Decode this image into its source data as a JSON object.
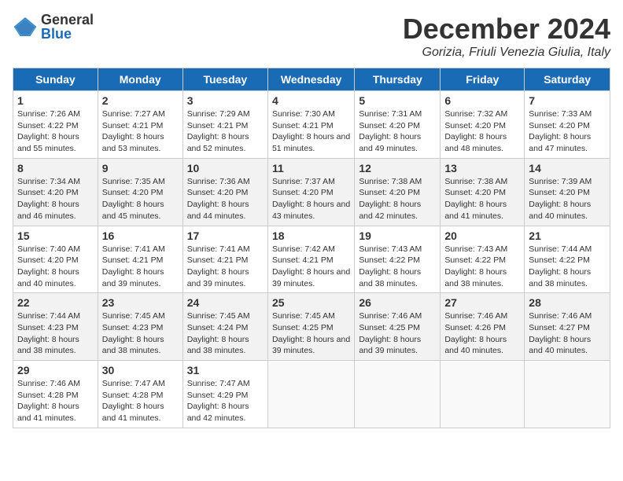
{
  "logo": {
    "general": "General",
    "blue": "Blue"
  },
  "title": "December 2024",
  "subtitle": "Gorizia, Friuli Venezia Giulia, Italy",
  "weekdays": [
    "Sunday",
    "Monday",
    "Tuesday",
    "Wednesday",
    "Thursday",
    "Friday",
    "Saturday"
  ],
  "weeks": [
    [
      {
        "day": "1",
        "sunrise": "7:26 AM",
        "sunset": "4:22 PM",
        "daylight": "8 hours and 55 minutes."
      },
      {
        "day": "2",
        "sunrise": "7:27 AM",
        "sunset": "4:21 PM",
        "daylight": "8 hours and 53 minutes."
      },
      {
        "day": "3",
        "sunrise": "7:29 AM",
        "sunset": "4:21 PM",
        "daylight": "8 hours and 52 minutes."
      },
      {
        "day": "4",
        "sunrise": "7:30 AM",
        "sunset": "4:21 PM",
        "daylight": "8 hours and 51 minutes."
      },
      {
        "day": "5",
        "sunrise": "7:31 AM",
        "sunset": "4:20 PM",
        "daylight": "8 hours and 49 minutes."
      },
      {
        "day": "6",
        "sunrise": "7:32 AM",
        "sunset": "4:20 PM",
        "daylight": "8 hours and 48 minutes."
      },
      {
        "day": "7",
        "sunrise": "7:33 AM",
        "sunset": "4:20 PM",
        "daylight": "8 hours and 47 minutes."
      }
    ],
    [
      {
        "day": "8",
        "sunrise": "7:34 AM",
        "sunset": "4:20 PM",
        "daylight": "8 hours and 46 minutes."
      },
      {
        "day": "9",
        "sunrise": "7:35 AM",
        "sunset": "4:20 PM",
        "daylight": "8 hours and 45 minutes."
      },
      {
        "day": "10",
        "sunrise": "7:36 AM",
        "sunset": "4:20 PM",
        "daylight": "8 hours and 44 minutes."
      },
      {
        "day": "11",
        "sunrise": "7:37 AM",
        "sunset": "4:20 PM",
        "daylight": "8 hours and 43 minutes."
      },
      {
        "day": "12",
        "sunrise": "7:38 AM",
        "sunset": "4:20 PM",
        "daylight": "8 hours and 42 minutes."
      },
      {
        "day": "13",
        "sunrise": "7:38 AM",
        "sunset": "4:20 PM",
        "daylight": "8 hours and 41 minutes."
      },
      {
        "day": "14",
        "sunrise": "7:39 AM",
        "sunset": "4:20 PM",
        "daylight": "8 hours and 40 minutes."
      }
    ],
    [
      {
        "day": "15",
        "sunrise": "7:40 AM",
        "sunset": "4:20 PM",
        "daylight": "8 hours and 40 minutes."
      },
      {
        "day": "16",
        "sunrise": "7:41 AM",
        "sunset": "4:21 PM",
        "daylight": "8 hours and 39 minutes."
      },
      {
        "day": "17",
        "sunrise": "7:41 AM",
        "sunset": "4:21 PM",
        "daylight": "8 hours and 39 minutes."
      },
      {
        "day": "18",
        "sunrise": "7:42 AM",
        "sunset": "4:21 PM",
        "daylight": "8 hours and 39 minutes."
      },
      {
        "day": "19",
        "sunrise": "7:43 AM",
        "sunset": "4:22 PM",
        "daylight": "8 hours and 38 minutes."
      },
      {
        "day": "20",
        "sunrise": "7:43 AM",
        "sunset": "4:22 PM",
        "daylight": "8 hours and 38 minutes."
      },
      {
        "day": "21",
        "sunrise": "7:44 AM",
        "sunset": "4:22 PM",
        "daylight": "8 hours and 38 minutes."
      }
    ],
    [
      {
        "day": "22",
        "sunrise": "7:44 AM",
        "sunset": "4:23 PM",
        "daylight": "8 hours and 38 minutes."
      },
      {
        "day": "23",
        "sunrise": "7:45 AM",
        "sunset": "4:23 PM",
        "daylight": "8 hours and 38 minutes."
      },
      {
        "day": "24",
        "sunrise": "7:45 AM",
        "sunset": "4:24 PM",
        "daylight": "8 hours and 38 minutes."
      },
      {
        "day": "25",
        "sunrise": "7:45 AM",
        "sunset": "4:25 PM",
        "daylight": "8 hours and 39 minutes."
      },
      {
        "day": "26",
        "sunrise": "7:46 AM",
        "sunset": "4:25 PM",
        "daylight": "8 hours and 39 minutes."
      },
      {
        "day": "27",
        "sunrise": "7:46 AM",
        "sunset": "4:26 PM",
        "daylight": "8 hours and 40 minutes."
      },
      {
        "day": "28",
        "sunrise": "7:46 AM",
        "sunset": "4:27 PM",
        "daylight": "8 hours and 40 minutes."
      }
    ],
    [
      {
        "day": "29",
        "sunrise": "7:46 AM",
        "sunset": "4:28 PM",
        "daylight": "8 hours and 41 minutes."
      },
      {
        "day": "30",
        "sunrise": "7:47 AM",
        "sunset": "4:28 PM",
        "daylight": "8 hours and 41 minutes."
      },
      {
        "day": "31",
        "sunrise": "7:47 AM",
        "sunset": "4:29 PM",
        "daylight": "8 hours and 42 minutes."
      },
      null,
      null,
      null,
      null
    ]
  ],
  "labels": {
    "sunrise": "Sunrise:",
    "sunset": "Sunset:",
    "daylight": "Daylight:"
  }
}
